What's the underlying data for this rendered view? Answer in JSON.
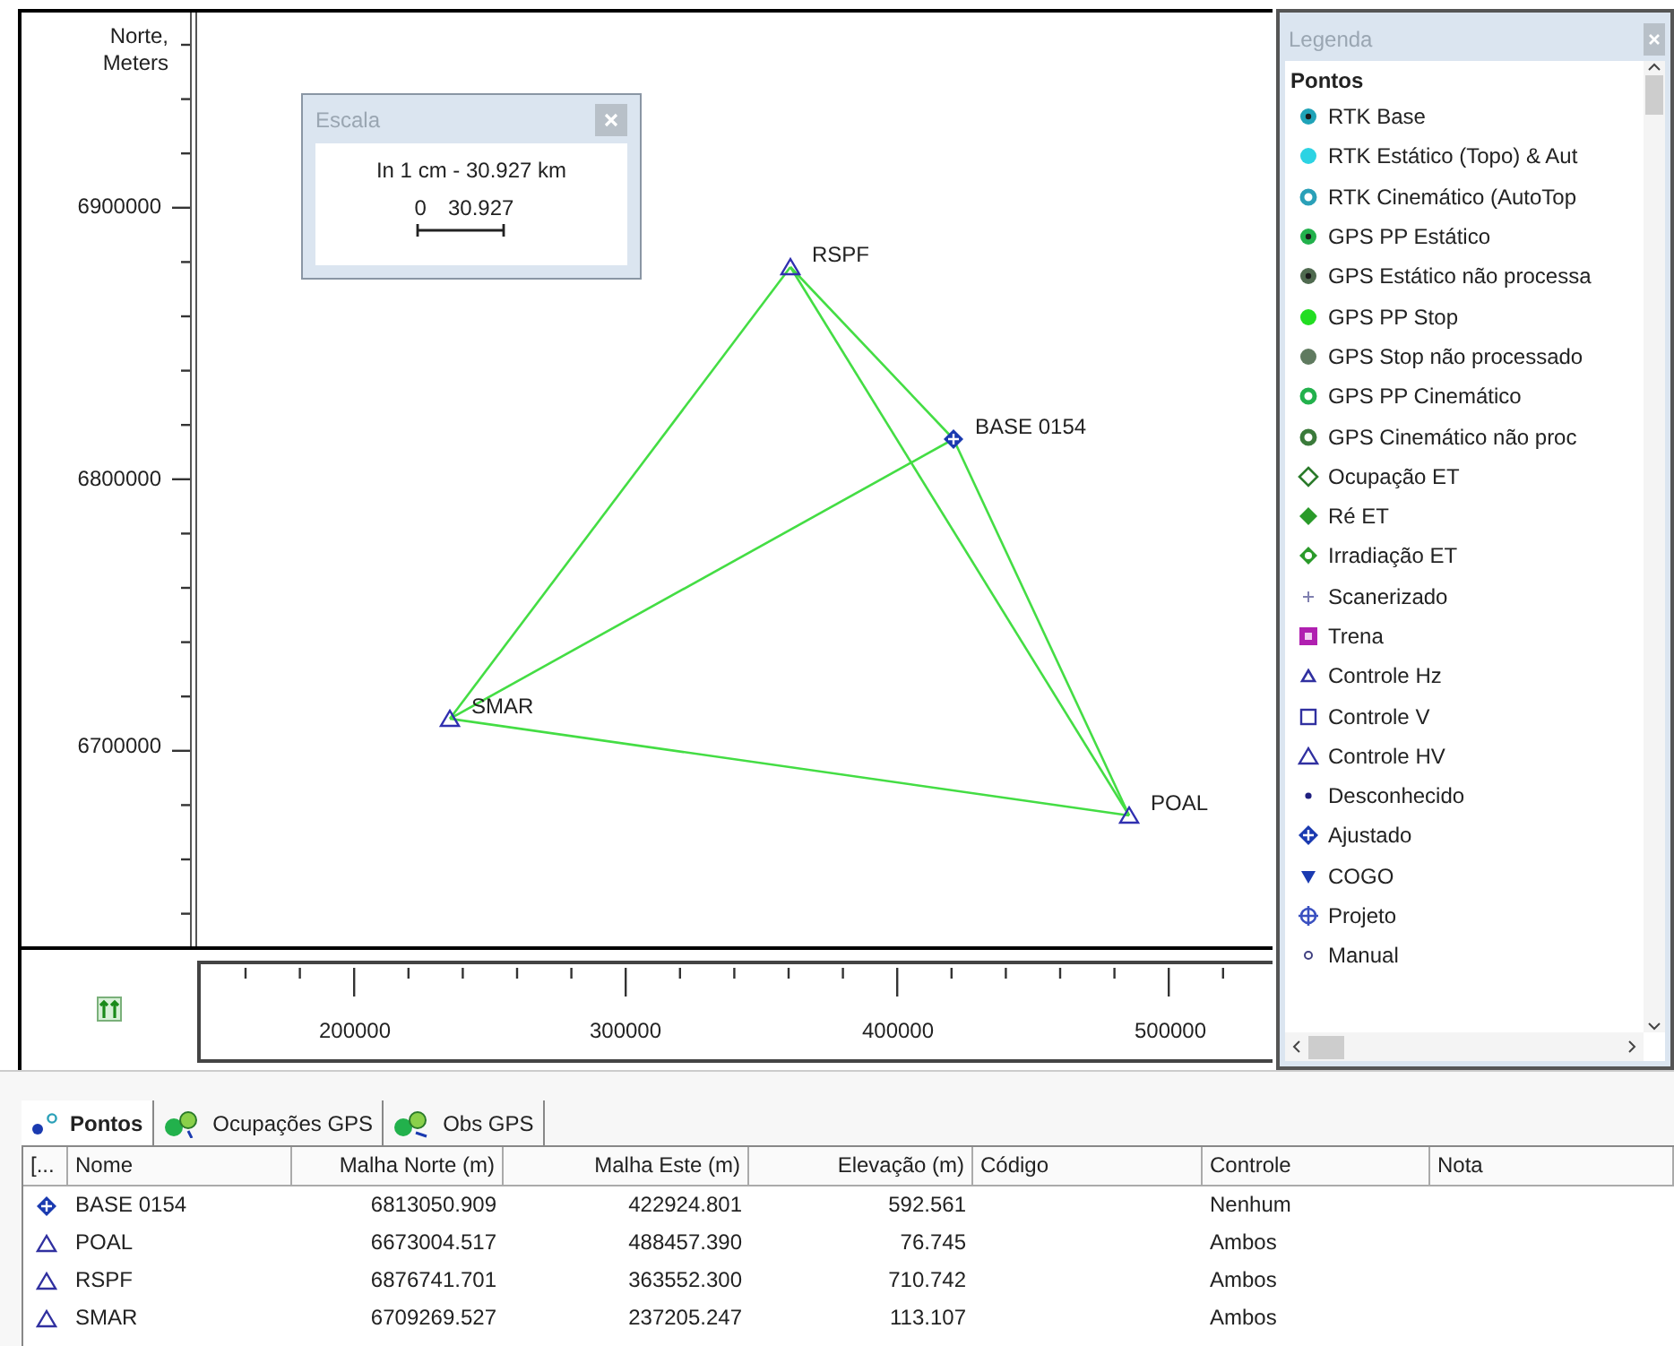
{
  "map": {
    "y_axis_title": "Norte, Meters",
    "y_ticks": [
      "6900000",
      "6800000",
      "6700000"
    ],
    "x_ticks": [
      "200000",
      "300000",
      "400000",
      "500000"
    ],
    "points": [
      {
        "label": "RSPF",
        "kind": "triangle"
      },
      {
        "label": "BASE 0154",
        "kind": "ajustado"
      },
      {
        "label": "SMAR",
        "kind": "triangle"
      },
      {
        "label": "POAL",
        "kind": "triangle"
      }
    ],
    "scale_window": {
      "title": "Escala",
      "text": "In 1 cm - 30.927 km",
      "start": "0",
      "end": "30.927"
    }
  },
  "legend": {
    "title": "Legenda",
    "group": "Pontos",
    "items": [
      {
        "label": "RTK Base",
        "kind": "dot-center",
        "color": "#1fa3b8"
      },
      {
        "label": "RTK Estático (Topo) & Aut",
        "kind": "dot",
        "color": "#2cd3e3"
      },
      {
        "label": "RTK Cinemático (AutoTop",
        "kind": "ring",
        "color": "#2aa0b8"
      },
      {
        "label": "GPS PP Estático",
        "kind": "dot-center",
        "color": "#22b14c"
      },
      {
        "label": "GPS Estático não processa",
        "kind": "dot-center",
        "color": "#4f6a4f"
      },
      {
        "label": "GPS PP Stop",
        "kind": "dot",
        "color": "#22dd22"
      },
      {
        "label": "GPS Stop não processado",
        "kind": "dot",
        "color": "#5f7a5f"
      },
      {
        "label": "GPS PP Cinemático",
        "kind": "ring",
        "color": "#22b14c"
      },
      {
        "label": "GPS Cinemático não proc",
        "kind": "ring",
        "color": "#3a7a3a"
      },
      {
        "label": "Ocupação ET",
        "kind": "diamond",
        "color": "#2a7a2a"
      },
      {
        "label": "Ré ET",
        "kind": "diamond-filled",
        "color": "#2a9a2a"
      },
      {
        "label": "Irradiação ET",
        "kind": "diamond-ring",
        "color": "#2a9a2a"
      },
      {
        "label": "Scanerizado",
        "kind": "plus",
        "color": "#8080b0"
      },
      {
        "label": "Trena",
        "kind": "square-filled",
        "color": "#b020b0"
      },
      {
        "label": "Controle Hz",
        "kind": "triangle-small",
        "color": "#3030a0"
      },
      {
        "label": "Controle V",
        "kind": "square",
        "color": "#3030a0"
      },
      {
        "label": "Controle HV",
        "kind": "triangle",
        "color": "#3030a0"
      },
      {
        "label": "Desconhecido",
        "kind": "small-dot",
        "color": "#202080"
      },
      {
        "label": "Ajustado",
        "kind": "ajustado",
        "color": "#1a3ab0"
      },
      {
        "label": "COGO",
        "kind": "down-triangle",
        "color": "#1a3ab0"
      },
      {
        "label": "Projeto",
        "kind": "crosshair",
        "color": "#3a50c0"
      },
      {
        "label": "Manual",
        "kind": "small-ring",
        "color": "#404080"
      }
    ]
  },
  "tabs": [
    {
      "label": "Pontos",
      "kind": "points",
      "selected": true
    },
    {
      "label": "Ocupações GPS",
      "kind": "occupations",
      "selected": false
    },
    {
      "label": "Obs GPS",
      "kind": "obs",
      "selected": false
    }
  ],
  "table": {
    "columns": [
      "[...",
      "Nome",
      "Malha Norte (m)",
      "Malha Este (m)",
      "Elevação (m)",
      "Código",
      "Controle",
      "Nota"
    ],
    "rows": [
      {
        "kind": "ajustado",
        "cells": [
          "",
          "BASE 0154",
          "6813050.909",
          "422924.801",
          "592.561",
          "",
          "Nenhum",
          ""
        ]
      },
      {
        "kind": "triangle",
        "cells": [
          "",
          "POAL",
          "6673004.517",
          "488457.390",
          "76.745",
          "",
          "Ambos",
          ""
        ]
      },
      {
        "kind": "triangle",
        "cells": [
          "",
          "RSPF",
          "6876741.701",
          "363552.300",
          "710.742",
          "",
          "Ambos",
          ""
        ]
      },
      {
        "kind": "triangle",
        "cells": [
          "",
          "SMAR",
          "6709269.527",
          "237205.247",
          "113.107",
          "",
          "Ambos",
          ""
        ]
      }
    ]
  }
}
